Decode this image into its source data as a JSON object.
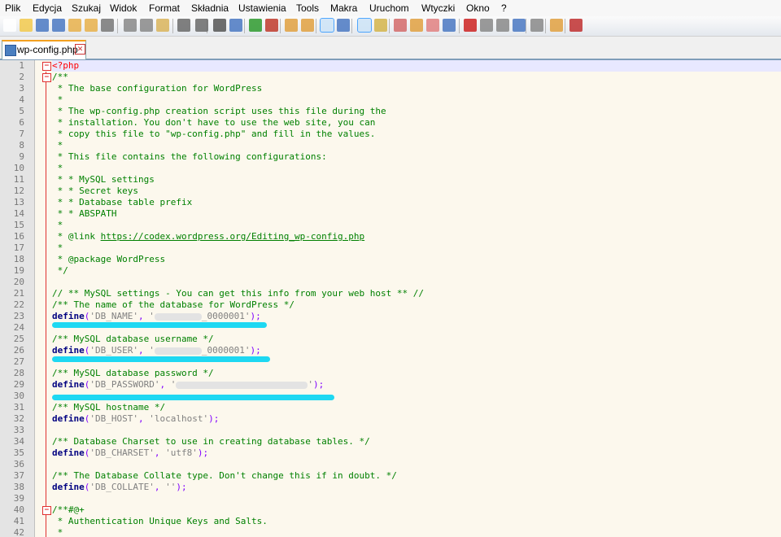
{
  "menu": [
    "Plik",
    "Edycja",
    "Szukaj",
    "Widok",
    "Format",
    "Składnia",
    "Ustawienia",
    "Tools",
    "Makra",
    "Uruchom",
    "Wtyczki",
    "Okno",
    "?"
  ],
  "tab": {
    "label": "wp-config.php",
    "close": "✕"
  },
  "lines": [
    {
      "n": "1",
      "segs": [
        {
          "t": "<?php",
          "c": "tag"
        }
      ]
    },
    {
      "n": "2",
      "segs": [
        {
          "t": "/**",
          "c": "comment"
        }
      ]
    },
    {
      "n": "3",
      "segs": [
        {
          "t": " * The base configuration for WordPress",
          "c": "comment"
        }
      ]
    },
    {
      "n": "4",
      "segs": [
        {
          "t": " *",
          "c": "comment"
        }
      ]
    },
    {
      "n": "5",
      "segs": [
        {
          "t": " * The wp-config.php creation script uses this file during the",
          "c": "comment"
        }
      ]
    },
    {
      "n": "6",
      "segs": [
        {
          "t": " * installation. You don't have to use the web site, you can",
          "c": "comment"
        }
      ]
    },
    {
      "n": "7",
      "segs": [
        {
          "t": " * copy this file to \"wp-config.php\" and fill in the values.",
          "c": "comment"
        }
      ]
    },
    {
      "n": "8",
      "segs": [
        {
          "t": " *",
          "c": "comment"
        }
      ]
    },
    {
      "n": "9",
      "segs": [
        {
          "t": " * This file contains the following configurations:",
          "c": "comment"
        }
      ]
    },
    {
      "n": "10",
      "segs": [
        {
          "t": " *",
          "c": "comment"
        }
      ]
    },
    {
      "n": "11",
      "segs": [
        {
          "t": " * * MySQL settings",
          "c": "comment"
        }
      ]
    },
    {
      "n": "12",
      "segs": [
        {
          "t": " * * Secret keys",
          "c": "comment"
        }
      ]
    },
    {
      "n": "13",
      "segs": [
        {
          "t": " * * Database table prefix",
          "c": "comment"
        }
      ]
    },
    {
      "n": "14",
      "segs": [
        {
          "t": " * * ABSPATH",
          "c": "comment"
        }
      ]
    },
    {
      "n": "15",
      "segs": [
        {
          "t": " *",
          "c": "comment"
        }
      ]
    },
    {
      "n": "16",
      "segs": [
        {
          "t": " * @link ",
          "c": "comment"
        },
        {
          "t": "https://codex.wordpress.org/Editing_wp-config.php",
          "c": "link"
        }
      ]
    },
    {
      "n": "17",
      "segs": [
        {
          "t": " *",
          "c": "comment"
        }
      ]
    },
    {
      "n": "18",
      "segs": [
        {
          "t": " * @package WordPress",
          "c": "comment"
        }
      ]
    },
    {
      "n": "19",
      "segs": [
        {
          "t": " */",
          "c": "comment"
        }
      ]
    },
    {
      "n": "20",
      "segs": []
    },
    {
      "n": "21",
      "segs": [
        {
          "t": "// ** MySQL settings - You can get this info from your web host ** //",
          "c": "comment"
        }
      ]
    },
    {
      "n": "22",
      "segs": [
        {
          "t": "/** The name of the database for WordPress */",
          "c": "comment"
        }
      ]
    },
    {
      "n": "23",
      "segs": [
        {
          "t": "define",
          "c": "kw"
        },
        {
          "t": "(",
          "c": "op"
        },
        {
          "t": "'DB_NAME'",
          "c": "str"
        },
        {
          "t": ", ",
          "c": "op"
        },
        {
          "t": "'",
          "c": "str"
        },
        {
          "t": "",
          "c": "blur",
          "w": 58
        },
        {
          "t": "_0000001'",
          "c": "str"
        },
        {
          "t": ");",
          "c": "op"
        }
      ]
    },
    {
      "n": "24",
      "segs": []
    },
    {
      "n": "25",
      "segs": [
        {
          "t": "/** MySQL database username */",
          "c": "comment"
        }
      ]
    },
    {
      "n": "26",
      "segs": [
        {
          "t": "define",
          "c": "kw"
        },
        {
          "t": "(",
          "c": "op"
        },
        {
          "t": "'DB_USER'",
          "c": "str"
        },
        {
          "t": ", ",
          "c": "op"
        },
        {
          "t": "'",
          "c": "str"
        },
        {
          "t": "",
          "c": "blur",
          "w": 58
        },
        {
          "t": "_0000001'",
          "c": "str"
        },
        {
          "t": ");",
          "c": "op"
        }
      ]
    },
    {
      "n": "27",
      "segs": []
    },
    {
      "n": "28",
      "segs": [
        {
          "t": "/** MySQL database password */",
          "c": "comment"
        }
      ]
    },
    {
      "n": "29",
      "segs": [
        {
          "t": "define",
          "c": "kw"
        },
        {
          "t": "(",
          "c": "op"
        },
        {
          "t": "'DB_PASSWORD'",
          "c": "str"
        },
        {
          "t": ", ",
          "c": "op"
        },
        {
          "t": "'",
          "c": "str"
        },
        {
          "t": "",
          "c": "blur",
          "w": 162
        },
        {
          "t": "'",
          "c": "str"
        },
        {
          "t": ");",
          "c": "op"
        }
      ]
    },
    {
      "n": "30",
      "segs": []
    },
    {
      "n": "31",
      "segs": [
        {
          "t": "/** MySQL hostname */",
          "c": "comment"
        }
      ]
    },
    {
      "n": "32",
      "segs": [
        {
          "t": "define",
          "c": "kw"
        },
        {
          "t": "(",
          "c": "op"
        },
        {
          "t": "'DB_HOST'",
          "c": "str"
        },
        {
          "t": ", ",
          "c": "op"
        },
        {
          "t": "'localhost'",
          "c": "str"
        },
        {
          "t": ");",
          "c": "op"
        }
      ]
    },
    {
      "n": "33",
      "segs": []
    },
    {
      "n": "34",
      "segs": [
        {
          "t": "/** Database Charset to use in creating database tables. */",
          "c": "comment"
        }
      ]
    },
    {
      "n": "35",
      "segs": [
        {
          "t": "define",
          "c": "kw"
        },
        {
          "t": "(",
          "c": "op"
        },
        {
          "t": "'DB_CHARSET'",
          "c": "str"
        },
        {
          "t": ", ",
          "c": "op"
        },
        {
          "t": "'utf8'",
          "c": "str"
        },
        {
          "t": ");",
          "c": "op"
        }
      ]
    },
    {
      "n": "36",
      "segs": []
    },
    {
      "n": "37",
      "segs": [
        {
          "t": "/** The Database Collate type. Don't change this if in doubt. */",
          "c": "comment"
        }
      ]
    },
    {
      "n": "38",
      "segs": [
        {
          "t": "define",
          "c": "kw"
        },
        {
          "t": "(",
          "c": "op"
        },
        {
          "t": "'DB_COLLATE'",
          "c": "str"
        },
        {
          "t": ", ",
          "c": "op"
        },
        {
          "t": "''",
          "c": "str"
        },
        {
          "t": ");",
          "c": "op"
        }
      ]
    },
    {
      "n": "39",
      "segs": []
    },
    {
      "n": "40",
      "segs": [
        {
          "t": "/**#@+",
          "c": "comment"
        }
      ]
    },
    {
      "n": "41",
      "segs": [
        {
          "t": " * Authentication Unique Keys and Salts.",
          "c": "comment"
        }
      ]
    },
    {
      "n": "42",
      "segs": [
        {
          "t": " *",
          "c": "comment"
        }
      ]
    }
  ],
  "toolbar_icons": [
    "new-icon",
    "open-icon",
    "save-icon",
    "save-all-icon",
    "close-icon",
    "close-all-icon",
    "print-icon",
    "cut-icon",
    "copy-icon",
    "paste-icon",
    "undo-icon",
    "redo-icon",
    "find-icon",
    "replace-icon",
    "zoom-in-icon",
    "zoom-out-icon",
    "sync-vertical-icon",
    "sync-horizontal-icon",
    "word-wrap-icon",
    "show-all-chars-icon",
    "indent-guide-icon",
    "doc-map-icon",
    "function-list-icon",
    "folder-workspace-icon",
    "clipboard-history-icon",
    "monitoring-icon",
    "record-macro-icon",
    "stop-record-icon",
    "play-macro-icon",
    "run-macro-multiple-icon",
    "save-macro-icon",
    "launch-browser-icon",
    "spellcheck-icon"
  ],
  "colors": {
    "editor_bg": "#fcf8ed",
    "comment": "#008000",
    "keyword": "#000080",
    "string": "#808080",
    "operator": "#8000ff",
    "php_tag": "#ff0000",
    "redaction_highlight": "#1ed8f2"
  }
}
